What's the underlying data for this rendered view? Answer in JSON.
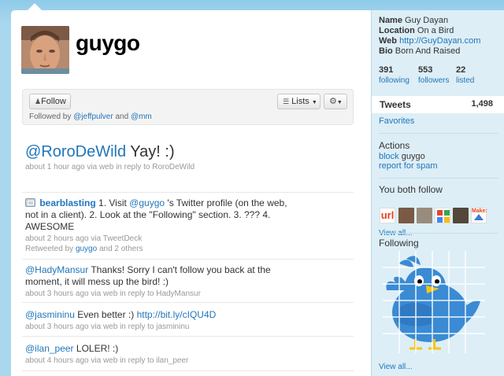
{
  "profile": {
    "screen_name": "guygo",
    "follow_label": "Follow",
    "lists_label": "Lists",
    "followed_by_prefix": "Followed by ",
    "followed_by_user1": "@jeffpulver",
    "followed_by_and": " and ",
    "followed_by_user2": "@mm"
  },
  "tweets": [
    {
      "mention": "@RoroDeWild",
      "text": " Yay! :)",
      "meta": "about 1 hour ago via web in reply to RoroDeWild"
    },
    {
      "author": "bearblasting",
      "text": " 1. Visit ",
      "mention": "@guygo",
      "text2": " 's Twitter profile (on the web, not in a client). 2. Look at the \"Following\" section. 3. ??? 4. AWESOME",
      "meta": "about 2 hours ago via TweetDeck",
      "retweet_prefix": "Retweeted by ",
      "retweet_user": "guygo",
      "retweet_suffix": " and 2 others"
    },
    {
      "mention": "@HadyMansur",
      "text": " Thanks! Sorry I can't follow you back at the moment, it will mess up the bird! :)",
      "meta": "about 3 hours ago via web in reply to HadyMansur"
    },
    {
      "mention": "@jasmininu",
      "text": " Even better :) ",
      "link": "http://bit.ly/cIQU4D",
      "meta": "about 3 hours ago via web in reply to jasmininu"
    },
    {
      "mention": "@ilan_peer",
      "text": " LOLER! :)",
      "meta": "about 4 hours ago via web in reply to ilan_peer"
    }
  ],
  "sidebar": {
    "name_label": "Name",
    "name_value": "Guy Dayan",
    "location_label": "Location",
    "location_value": "On a Bird",
    "web_label": "Web",
    "web_value": "http://GuyDayan.com",
    "bio_label": "Bio",
    "bio_value": "Born And Raised",
    "following_count": "391",
    "following_label": "following",
    "followers_count": "553",
    "followers_label": "followers",
    "listed_count": "22",
    "listed_label": "listed",
    "tweets_label": "Tweets",
    "tweets_count": "1,498",
    "favorites_label": "Favorites",
    "actions_heading": "Actions",
    "block_label": "block",
    "block_user": "guygo",
    "report_label": "report for spam",
    "both_follow_heading": "You both follow",
    "view_all_1": "View all...",
    "following_heading": "Following",
    "view_all_2": "View all...",
    "url_badge": "url",
    "make_badge": "Make:"
  },
  "colors": {
    "link": "#2276bb",
    "background": "#a9d7ee",
    "sidebar": "#ddeef6",
    "bird": "#3a8bd4"
  }
}
